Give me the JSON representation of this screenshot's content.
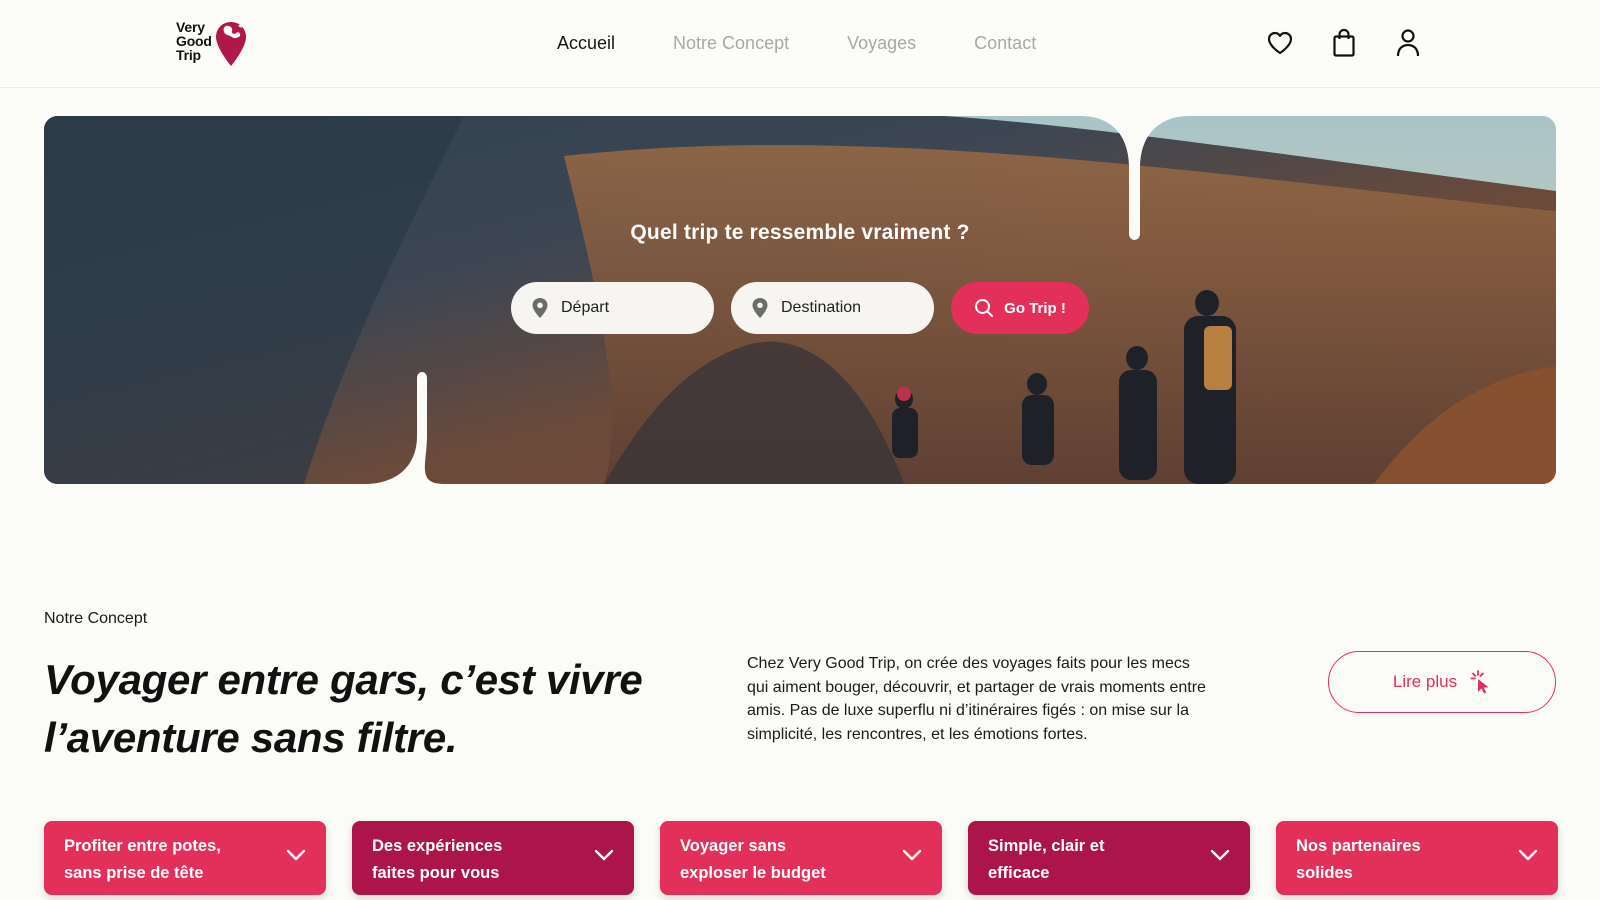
{
  "brand": {
    "logo_lines": [
      "Very",
      "Good",
      "Trip"
    ],
    "accent": "#e2305a",
    "accent_dark": "#b0174a"
  },
  "nav": {
    "items": [
      {
        "label": "Accueil",
        "active": true
      },
      {
        "label": "Notre Concept",
        "active": false
      },
      {
        "label": "Voyages",
        "active": false
      },
      {
        "label": "Contact",
        "active": false
      }
    ]
  },
  "header_icons": [
    "heart-icon",
    "shopping-bag-icon",
    "user-icon"
  ],
  "hero": {
    "title": "Quel trip te ressemble vraiment ?",
    "departure_placeholder": "Départ",
    "destination_placeholder": "Destination",
    "search_button": "Go Trip !"
  },
  "concept": {
    "section_label": "Notre Concept",
    "headline_line1": "Voyager entre gars, c’est vivre",
    "headline_line2": "l’aventure sans filtre.",
    "paragraph": "Chez Very Good Trip, on crée des voyages faits pour les mecs qui aiment bouger, découvrir, et partager de vrais moments entre amis. Pas de luxe superflu ni d’itinéraires figés : on mise sur la simplicité, les rencontres, et les émotions fortes.",
    "read_more": "Lire plus"
  },
  "cards": [
    {
      "line1": "Profiter entre potes,",
      "line2": "sans prise de tête",
      "color": "#e2305a"
    },
    {
      "line1": "Des expériences",
      "line2": "faites pour vous",
      "color": "#ab1549"
    },
    {
      "line1": "Voyager sans",
      "line2": "exploser le budget",
      "color": "#e2305a"
    },
    {
      "line1": "Simple, clair et",
      "line2": "efficace",
      "color": "#ab1549"
    },
    {
      "line1": "Nos partenaires",
      "line2": "solides",
      "color": "#e2305a"
    }
  ]
}
